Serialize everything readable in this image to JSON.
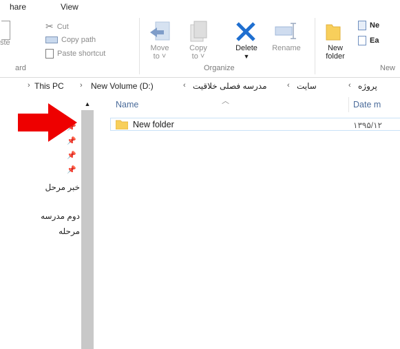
{
  "ribbon_tabs": [
    "hare",
    "View"
  ],
  "clipboard": {
    "cut_label": "Cut",
    "copy_path_label": "Copy path",
    "paste_shortcut_label": "Paste shortcut",
    "paste_partial": "ste",
    "group_label_partial": "ard"
  },
  "organize": {
    "move_to_label": "Move",
    "move_to_sub": "to",
    "copy_to_label": "Copy",
    "copy_to_sub": "to",
    "delete_label": "Delete",
    "rename_label": "Rename",
    "group_label": "Organize"
  },
  "new_group": {
    "new_folder_line1": "New",
    "new_folder_line2": "folder",
    "new_item_partial": "Ne",
    "easy_access_partial": "Ea",
    "group_label_partial": "New"
  },
  "address": {
    "crumbs": [
      "This PC",
      "New Volume (D:)",
      "مدرسه فصلی خلاقیت",
      "سایت",
      "پروژه"
    ]
  },
  "nav_items": [
    "خبر مرحل",
    "دوم مدرسه",
    "مرحله"
  ],
  "columns": {
    "name": "Name",
    "date_partial": "Date m"
  },
  "files": [
    {
      "name": "New folder",
      "date_partial": "۱۳۹۵/۱۲"
    }
  ],
  "colors": {
    "arrow": "#ee0000",
    "folder": "#f8cf5b",
    "accent_blue": "#1f6fd0"
  }
}
